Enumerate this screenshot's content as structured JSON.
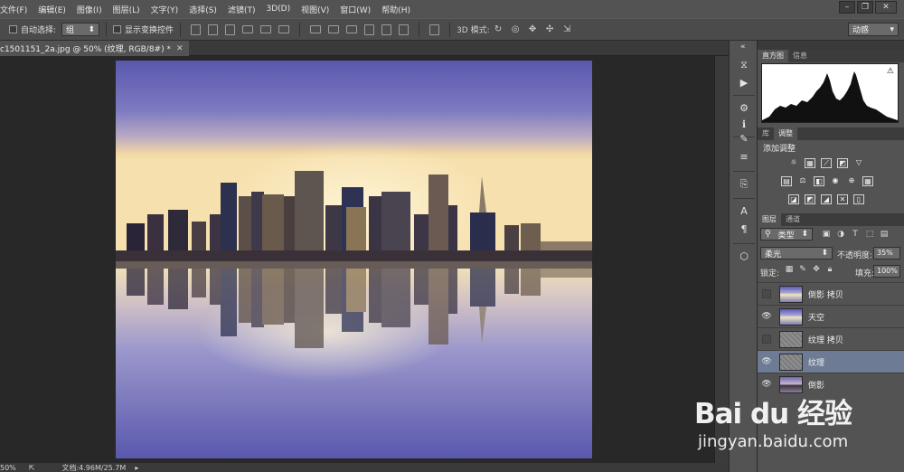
{
  "menubar": {
    "items": [
      "文件(F)",
      "编辑(E)",
      "图像(I)",
      "图层(L)",
      "文字(Y)",
      "选择(S)",
      "滤镜(T)",
      "3D(D)",
      "视图(V)",
      "窗口(W)",
      "帮助(H)"
    ]
  },
  "options": {
    "auto_select_label": "自动选择:",
    "auto_select_value": "组",
    "show_transform_label": "显示变换控件",
    "mode_3d_label": "3D 模式:",
    "workspace": "动感"
  },
  "document": {
    "tab_title": "c1501151_2a.jpg @ 50% (纹理, RGB/8#) *",
    "zoom": "50%",
    "doc_size": "文档:4.96M/25.7M"
  },
  "panels": {
    "histogram_tabs": [
      "直方图",
      "信息"
    ],
    "adjust_tabs": [
      "库",
      "调整"
    ],
    "adjust_title": "添加调整",
    "layers_tabs": [
      "图层",
      "通道"
    ],
    "filter_kind": "类型",
    "blend_mode": "柔光",
    "opacity_label": "不透明度:",
    "opacity_value": "35%",
    "lock_label": "锁定:",
    "fill_label": "填充:",
    "fill_value": "100%"
  },
  "layers": [
    {
      "name": "倒影 拷贝",
      "visible": false,
      "thumb": "city2",
      "selected": false
    },
    {
      "name": "天空",
      "visible": true,
      "thumb": "city2",
      "selected": false
    },
    {
      "name": "纹理 拷贝",
      "visible": false,
      "thumb": "tex",
      "selected": false
    },
    {
      "name": "纹理",
      "visible": true,
      "thumb": "tex",
      "selected": true
    },
    {
      "name": "倒影",
      "visible": true,
      "thumb": "city",
      "selected": false
    }
  ],
  "watermark": {
    "logo": "Bai du 经验",
    "url": "jingyan.baidu.com"
  },
  "colors": {
    "selected_layer": "#6d7b94",
    "panel_bg": "#535353",
    "canvas_bg": "#282828"
  }
}
